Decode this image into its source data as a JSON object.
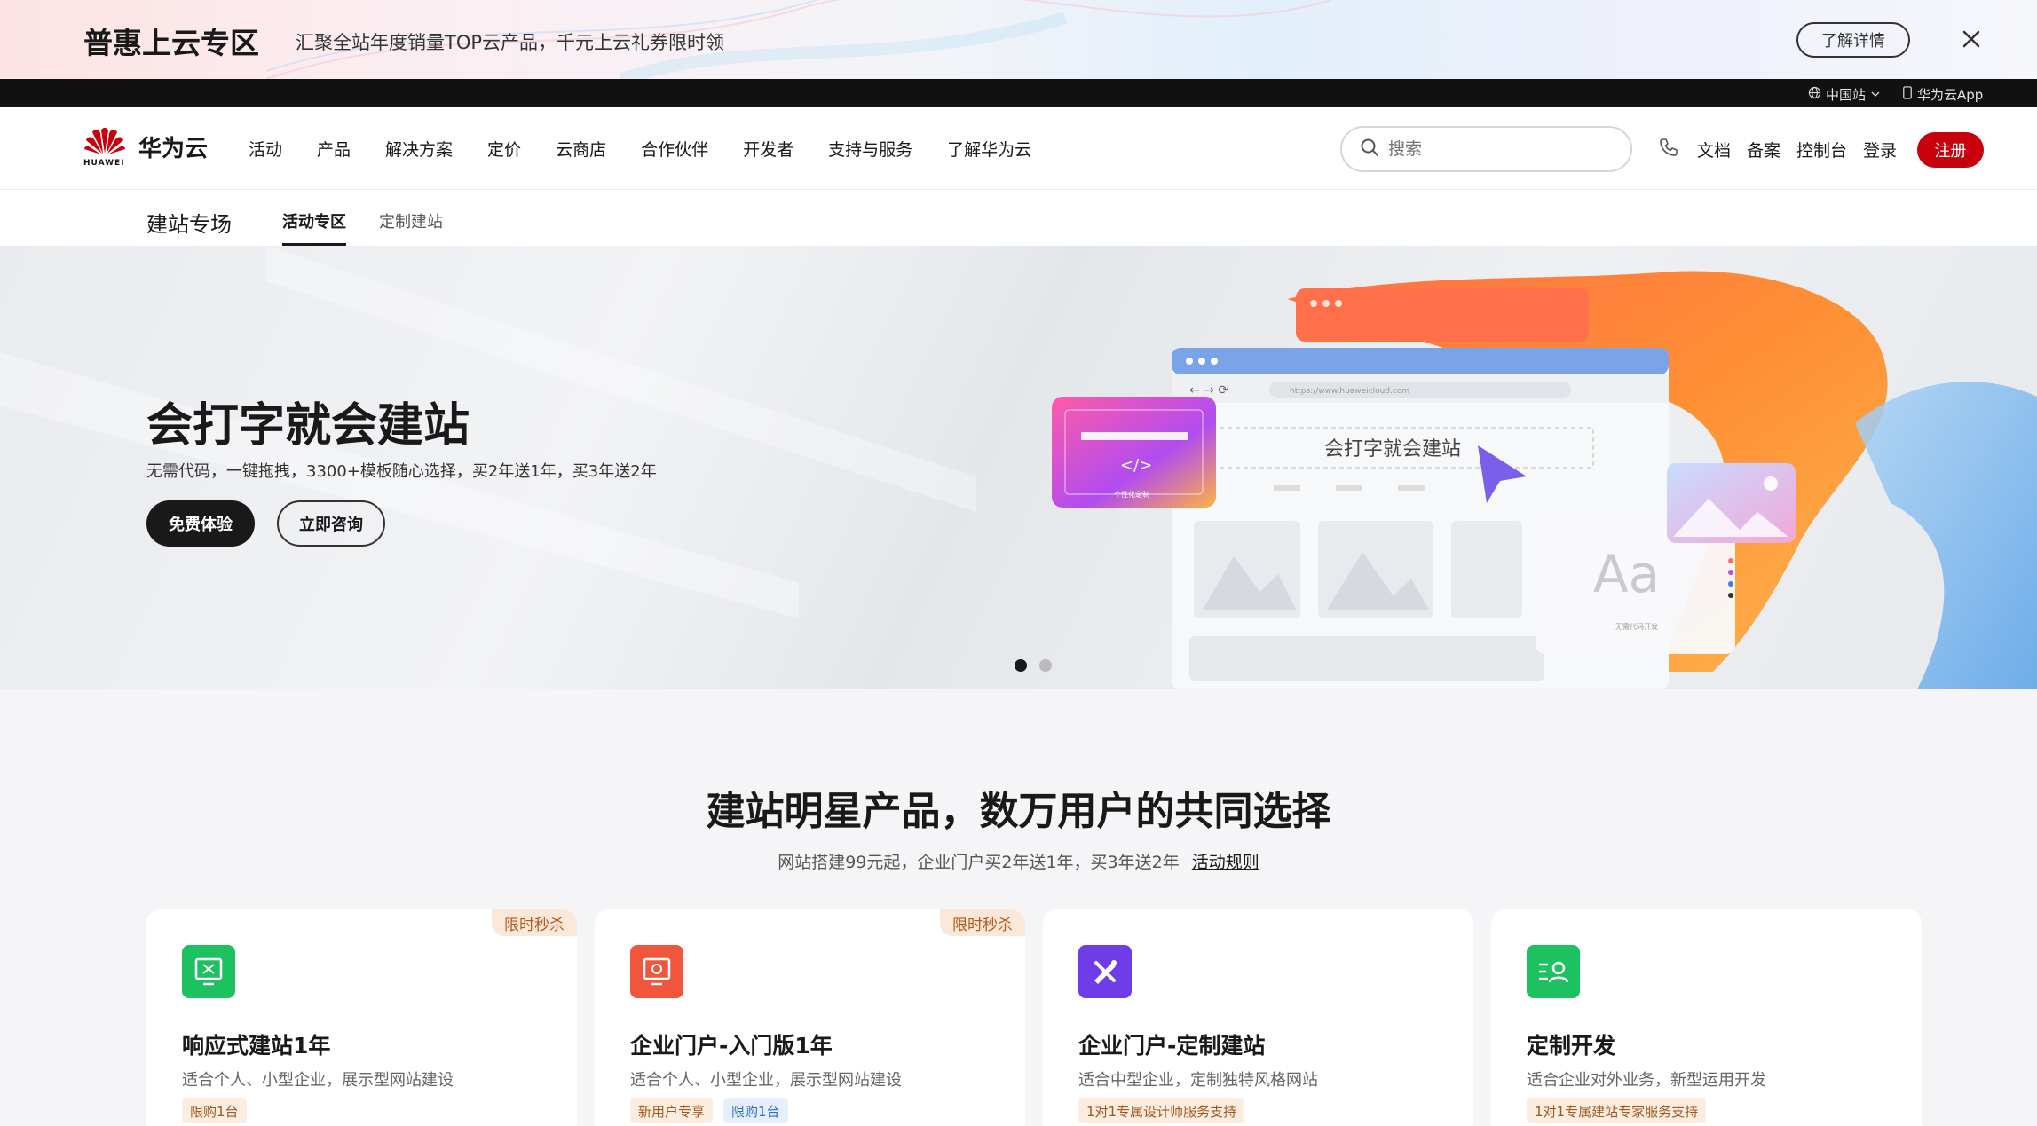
{
  "promo": {
    "title": "普惠上云专区",
    "subtitle": "汇聚全站年度销量TOP云产品，千元上云礼券限时领",
    "button": "了解详情"
  },
  "top_strip": {
    "region": "中国站",
    "app": "华为云App"
  },
  "nav": {
    "logo_text": "华为云",
    "logo_small": "HUAWEI",
    "items": [
      "活动",
      "产品",
      "解决方案",
      "定价",
      "云商店",
      "合作伙伴",
      "开发者",
      "支持与服务",
      "了解华为云"
    ],
    "search_placeholder": "搜索",
    "right_items": [
      "文档",
      "备案",
      "控制台",
      "登录"
    ],
    "register": "注册"
  },
  "subnav": {
    "title": "建站专场",
    "tabs": [
      "活动专区",
      "定制建站"
    ]
  },
  "hero": {
    "title": "会打字就会建站",
    "subtitle": "无需代码，一键拖拽，3300+模板随心选择，买2年送1年，买3年送2年",
    "btn_primary": "免费体验",
    "btn_secondary": "立即咨询",
    "art_browser_text": "会打字就会建站",
    "art_url": "https://www.huaweicloud.com",
    "art_code": "</>",
    "art_code_label": "个性化定制",
    "art_font": "Aa",
    "art_font_label": "无需代码开发",
    "slide_count": 2,
    "active_slide": 1
  },
  "section": {
    "title": "建站明星产品，数万用户的共同选择",
    "subtitle": "网站搭建99元起，企业门户买2年送1年，买3年送2年",
    "link": "活动规则"
  },
  "cards": [
    {
      "tag": "限时秒杀",
      "title": "响应式建站1年",
      "desc": "适合个人、小型企业，展示型网站建设",
      "badges": [
        "限购1台"
      ],
      "icon": "monitor-icon",
      "color": "#1ec15f"
    },
    {
      "tag": "限时秒杀",
      "title": "企业门户-入门版1年",
      "desc": "适合个人、小型企业，展示型网站建设",
      "badges": [
        "新用户专享",
        "限购1台"
      ],
      "icon": "portal-icon",
      "color": "#f0563b"
    },
    {
      "tag": "",
      "title": "企业门户-定制建站",
      "desc": "适合中型企业，定制独特风格网站",
      "badges": [
        "1对1专属设计师服务支持"
      ],
      "icon": "design-tools-icon",
      "color": "#6f3de8"
    },
    {
      "tag": "",
      "title": "定制开发",
      "desc": "适合企业对外业务，新型运用开发",
      "badges": [
        "1对1专属建站专家服务支持"
      ],
      "icon": "dev-user-icon",
      "color": "#1ec15f"
    }
  ]
}
